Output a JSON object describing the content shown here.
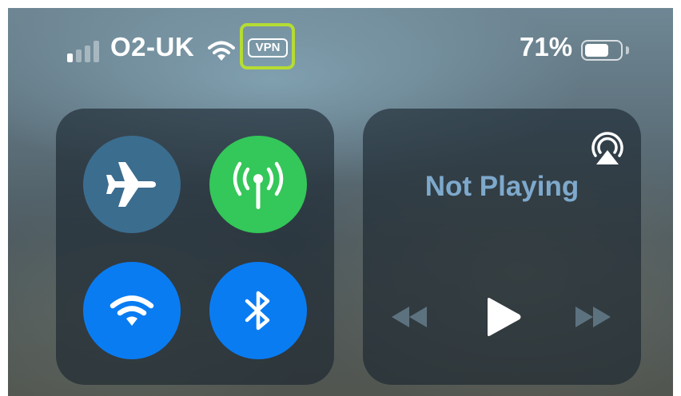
{
  "status_bar": {
    "signal_bars_active": 1,
    "signal_bars_total": 4,
    "carrier": "O2-UK",
    "wifi_icon": "wifi-icon",
    "vpn_label": "VPN",
    "vpn_highlight_color": "#b5dc33",
    "battery_percent_label": "71%",
    "battery_level": 0.71
  },
  "connectivity": {
    "airplane_mode": {
      "icon": "airplane-icon",
      "active": false,
      "color": "#3b6d8f"
    },
    "cellular_data": {
      "icon": "antenna-icon",
      "active": true,
      "color": "#34c759"
    },
    "wifi": {
      "icon": "wifi-icon",
      "active": true,
      "color": "#0a7cf2"
    },
    "bluetooth": {
      "icon": "bluetooth-icon",
      "active": true,
      "color": "#0a7cf2"
    }
  },
  "media": {
    "airplay_icon": "airplay-audio-icon",
    "status": "Not Playing",
    "status_color": "#7ea9cc",
    "controls": [
      "rewind-icon",
      "play-icon",
      "fast-forward-icon"
    ]
  }
}
